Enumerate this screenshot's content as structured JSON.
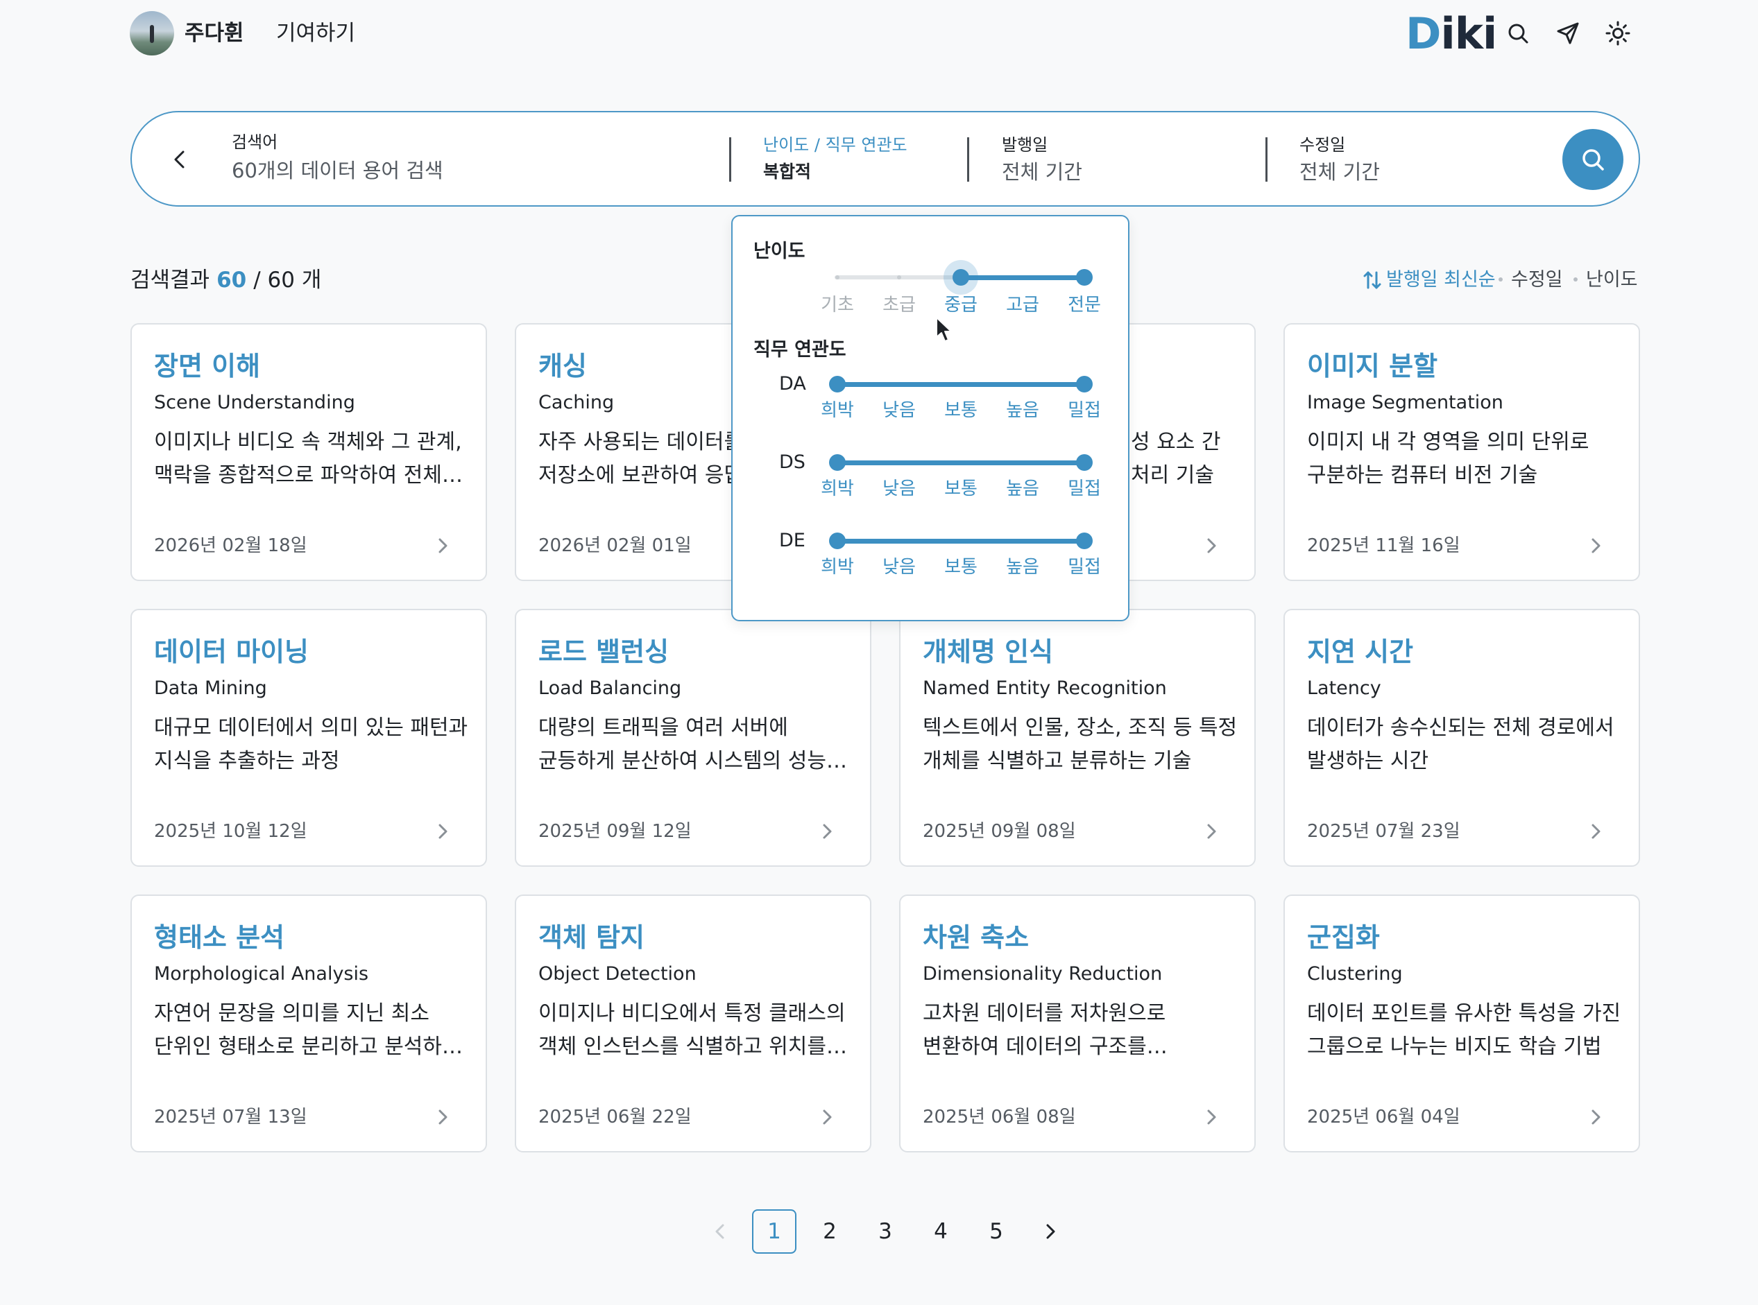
{
  "header": {
    "user_name": "주다휜",
    "contribute_label": "기여하기",
    "logo_first": "D",
    "logo_rest": "iki",
    "icons": [
      "search-icon",
      "send-icon",
      "sun-icon"
    ],
    "brand_color": "#3c8fc2"
  },
  "search": {
    "keyword_label": "검색어",
    "keyword_placeholder": "60개의 데이터 용어 검색",
    "filter_label": "난이도 / 직무 연관도",
    "filter_value": "복합적",
    "published_label": "발행일",
    "published_value": "전체 기간",
    "modified_label": "수정일",
    "modified_value": "전체 기간"
  },
  "results": {
    "prefix": "검색결과",
    "count": "60",
    "suffix": "/ 60 개"
  },
  "sort": {
    "published": "발행일 최신순",
    "modified": "수정일",
    "difficulty": "난이도"
  },
  "popover": {
    "difficulty_title": "난이도",
    "difficulty_levels": [
      "기초",
      "초급",
      "중급",
      "고급",
      "전문"
    ],
    "difficulty_range": [
      2,
      4
    ],
    "relevance_title": "직무 연관도",
    "relevance_levels": [
      "희박",
      "낮음",
      "보통",
      "높음",
      "밀접"
    ],
    "rows": [
      {
        "label": "DA",
        "range": [
          0,
          4
        ]
      },
      {
        "label": "DS",
        "range": [
          0,
          4
        ]
      },
      {
        "label": "DE",
        "range": [
          0,
          4
        ]
      }
    ]
  },
  "cards": [
    {
      "title": "장면 이해",
      "english": "Scene Understanding",
      "desc": "이미지나 비디오 속 객체와 그 관계, 맥락을 종합적으로 파악하여 전체 장면의 의미를 이해하는 기술",
      "date": "2026년 02월 18일"
    },
    {
      "title": "캐싱",
      "english": "Caching",
      "desc": "자주 사용되는 데이터를 빠른 저장소에 보관하여 응답 속도를 높이는 기술",
      "date": "2026년 02월 01일"
    },
    {
      "title": "",
      "english": "",
      "desc": "성 요소 간 처리 기술",
      "date": ""
    },
    {
      "title": "이미지 분할",
      "english": "Image Segmentation",
      "desc": "이미지 내 각 영역을 의미 단위로 구분하는 컴퓨터 비전 기술",
      "date": "2025년 11월 16일"
    },
    {
      "title": "데이터 마이닝",
      "english": "Data Mining",
      "desc": "대규모 데이터에서 의미 있는 패턴과 지식을 추출하는 과정",
      "date": "2025년 10월 12일"
    },
    {
      "title": "로드 밸런싱",
      "english": "Load Balancing",
      "desc": "대량의 트래픽을 여러 서버에 균등하게 분산하여 시스템의 성능과 가용성을 높이는 기술",
      "date": "2025년 09월 12일"
    },
    {
      "title": "개체명 인식",
      "english": "Named Entity Recognition",
      "desc": "텍스트에서 인물, 장소, 조직 등 특정 개체를 식별하고 분류하는 기술",
      "date": "2025년 09월 08일"
    },
    {
      "title": "지연 시간",
      "english": "Latency",
      "desc": "데이터가 송수신되는 전체 경로에서 발생하는 시간",
      "date": "2025년 07월 23일"
    },
    {
      "title": "형태소 분석",
      "english": "Morphological Analysis",
      "desc": "자연어 문장을 의미를 지닌 최소 단위인 형태소로 분리하고 분석하는 기술",
      "date": "2025년 07월 13일"
    },
    {
      "title": "객체 탐지",
      "english": "Object Detection",
      "desc": "이미지나 비디오에서 특정 클래스의 객체 인스턴스를 식별하고 위치를 찾는 기술",
      "date": "2025년 06월 22일"
    },
    {
      "title": "차원 축소",
      "english": "Dimensionality Reduction",
      "desc": "고차원 데이터를 저차원으로 변환하여 데이터의 구조를 단순화하는 기술",
      "date": "2025년 06월 08일"
    },
    {
      "title": "군집화",
      "english": "Clustering",
      "desc": "데이터 포인트를 유사한 특성을 가진 그룹으로 나누는 비지도 학습 기법",
      "date": "2025년 06월 04일"
    }
  ],
  "pagination": {
    "pages": [
      "1",
      "2",
      "3",
      "4",
      "5"
    ],
    "current": "1"
  }
}
